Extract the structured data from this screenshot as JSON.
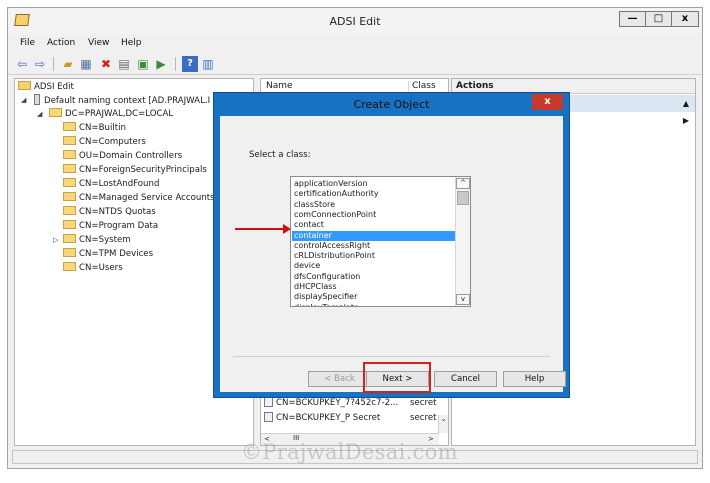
{
  "window": {
    "title": "ADSI Edit",
    "controls": {
      "minimize": "—",
      "maximize": "□",
      "close": "x"
    }
  },
  "menu": [
    "File",
    "Action",
    "View",
    "Help"
  ],
  "tree": {
    "root": "ADSI Edit",
    "context": "Default naming context [AD.PRAJWAL.I",
    "domain": "DC=PRAJWAL,DC=LOCAL",
    "items": [
      "CN=Builtin",
      "CN=Computers",
      "OU=Domain Controllers",
      "CN=ForeignSecurityPrincipals",
      "CN=LostAndFound",
      "CN=Managed Service Accounts",
      "CN=NTDS Quotas",
      "CN=Program Data",
      "CN=System",
      "CN=TPM Devices",
      "CN=Users"
    ]
  },
  "list": {
    "columns": [
      "Name",
      "Class"
    ],
    "rows": [
      {
        "name": "CN=BCKUPKEY_7?452c7-2...",
        "class": "secret"
      },
      {
        "name": "CN=BCKUPKEY_P Secret",
        "class": "secret"
      }
    ],
    "hscroll_label": "III"
  },
  "actions": {
    "title": "Actions"
  },
  "dialog": {
    "title": "Create Object",
    "close": "x",
    "prompt": "Select a class:",
    "classes": [
      "applicationVersion",
      "certificationAuthority",
      "classStore",
      "comConnectionPoint",
      "contact",
      "container",
      "controlAccessRight",
      "cRLDistributionPoint",
      "device",
      "dfsConfiguration",
      "dHCPClass",
      "displaySpecifier",
      "displayTemplate"
    ],
    "selected_class": "container",
    "buttons": {
      "back": "< Back",
      "next": "Next >",
      "cancel": "Cancel",
      "help": "Help"
    }
  },
  "watermark": "©PrajwalDesai.com",
  "colors": {
    "dialog_frame": "#1872c4",
    "selection": "#3399ff",
    "annotation_red": "#d42020"
  }
}
